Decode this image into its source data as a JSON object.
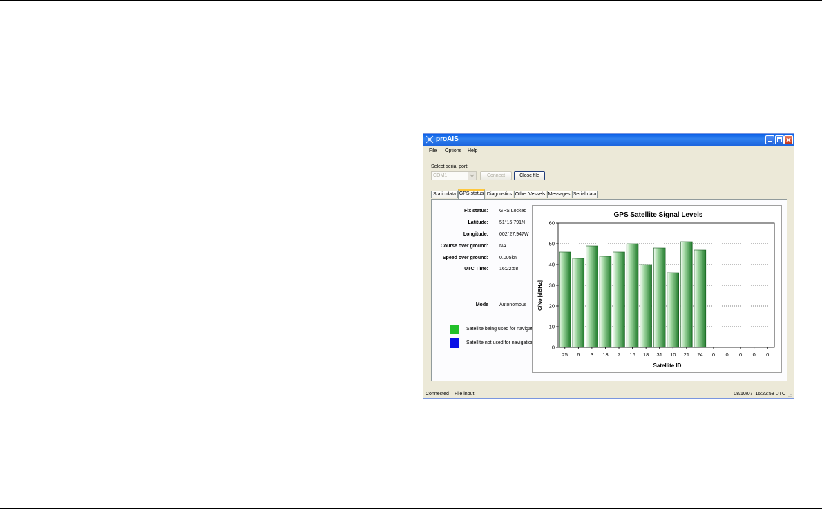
{
  "window": {
    "title": "proAIS"
  },
  "menu": {
    "items": [
      "File",
      "Options",
      "Help"
    ]
  },
  "serial": {
    "label": "Select serial port:",
    "port": "COM1",
    "connect_label": "Connect",
    "close_file_label": "Close file"
  },
  "tabs": [
    "Static data",
    "GPS status",
    "Diagnostics",
    "Other Vessels",
    "Messages",
    "Serial data"
  ],
  "active_tab": "GPS status",
  "gps": {
    "fields": [
      {
        "label": "Fix status:",
        "value": "GPS Locked"
      },
      {
        "label": "Latitude:",
        "value": "51°16.791N"
      },
      {
        "label": "Longitude:",
        "value": "002°27.947W"
      },
      {
        "label": "Course over ground:",
        "value": "NA"
      },
      {
        "label": "Speed over ground:",
        "value": "0.005kn"
      },
      {
        "label": "UTC Time:",
        "value": "16:22:58"
      }
    ],
    "mode_label": "Mode",
    "mode_value": "Autonomous"
  },
  "legend": [
    {
      "label": "Satellite being used for navigation",
      "color": "#22c02a"
    },
    {
      "label": "Satellite not used for navigation",
      "color": "#0a10e6"
    }
  ],
  "chart_data": {
    "type": "bar",
    "title": "GPS Satellite Signal Levels",
    "xlabel": "Satellite ID",
    "ylabel": "C/No [dBHz]",
    "categories": [
      "25",
      "6",
      "3",
      "13",
      "7",
      "16",
      "18",
      "31",
      "10",
      "21",
      "24",
      "0",
      "0",
      "0",
      "0",
      "0"
    ],
    "values": [
      46,
      43,
      49,
      44,
      46,
      50,
      40,
      48,
      36,
      51,
      47,
      0,
      0,
      0,
      0,
      0
    ],
    "ylim": [
      0,
      60
    ],
    "yticks": [
      0,
      10,
      20,
      30,
      40,
      50,
      60
    ],
    "bar_color": "#2f9a3a",
    "grid": "dotted horizontal",
    "legend": "none"
  },
  "statusbar": {
    "connection": "Connected",
    "source": "File input",
    "timestamp": "08/10/07  16:22:58 UTC"
  }
}
